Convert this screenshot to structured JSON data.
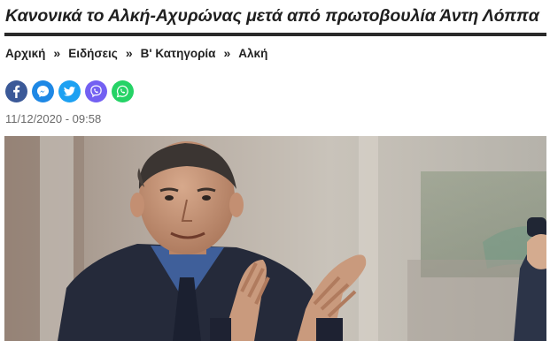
{
  "article": {
    "title": "Κανονικά το Αλκή-Αχυρώνας μετά από πρωτοβουλία Άντη Λόππα",
    "date": "11/12/2020 - 09:58"
  },
  "breadcrumb": {
    "items": [
      "Αρχική",
      "Ειδήσεις",
      "Β' Κατηγορία",
      "Αλκή"
    ],
    "separator": "»"
  },
  "share": {
    "buttons": [
      {
        "icon": "facebook-icon",
        "color": "#3b5998"
      },
      {
        "icon": "messenger-icon",
        "color": "#1e88e5"
      },
      {
        "icon": "twitter-icon",
        "color": "#1da1f2"
      },
      {
        "icon": "viber-icon",
        "color": "#7360f2"
      },
      {
        "icon": "whatsapp-icon",
        "color": "#25d366"
      }
    ]
  },
  "colors": {
    "headline": "#1f1f1f",
    "rule": "#2a2a2a",
    "date": "#6a6a6a"
  }
}
